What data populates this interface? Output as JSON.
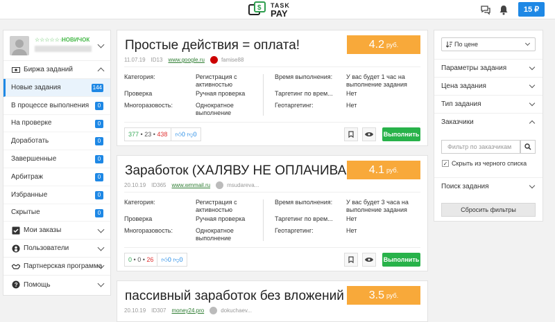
{
  "header": {
    "logo_top": "TASK",
    "logo_bottom": "PAY",
    "balance": "15 ₽",
    "colors": {
      "accent": "#1e88e5",
      "green": "#28b24a",
      "price": "#f8a93a"
    }
  },
  "sidebar": {
    "user": {
      "stars": "☆☆☆☆☆☆",
      "rank": "НОВИЧОК"
    },
    "section_tasks": "Биржа заданий",
    "items": [
      {
        "label": "Новые задания",
        "count": "144"
      },
      {
        "label": "В процессе выполнения",
        "count": "0"
      },
      {
        "label": "На проверке",
        "count": "0"
      },
      {
        "label": "Доработать",
        "count": "0"
      },
      {
        "label": "Завершенные",
        "count": "0"
      },
      {
        "label": "Арбитраж",
        "count": "0"
      },
      {
        "label": "Избранные",
        "count": "0"
      },
      {
        "label": "Скрытые",
        "count": "0"
      }
    ],
    "my_orders": "Мои заказы",
    "users": "Пользователи",
    "partner": "Партнерская программа",
    "help": "Помощь"
  },
  "tasks": [
    {
      "title": "Простые действия = оплата!",
      "price": "4.2",
      "currency": "руб.",
      "date": "11.07.19",
      "id": "ID13",
      "site": "www.google.ru",
      "author": "famise88",
      "category": "Регистрация с активностью",
      "check": "Ручная проверка",
      "repeat": "Однократное выполнение",
      "time": "У вас будет 1 час на выполнение задания",
      "targeting": "Нет",
      "geo": "Нет",
      "stat_green": "377",
      "stat_dark": "23",
      "stat_red": "438",
      "likes": "0",
      "dislikes": "0"
    },
    {
      "title": "Заработок (ХАЛЯВУ НЕ ОПЛАЧИВАЮ !!!...",
      "price": "4.1",
      "currency": "руб.",
      "date": "20.10.19",
      "id": "ID365",
      "site": "www.wmmail.ru",
      "author": "msudareva...",
      "category": "Регистрация с активностью",
      "check": "Ручная проверка",
      "repeat": "Однократное выполнение",
      "time": "У вас будет 3 часа на выполнение задания",
      "targeting": "Нет",
      "geo": "Нет",
      "stat_green": "0",
      "stat_dark": "0",
      "stat_red": "26",
      "likes": "0",
      "dislikes": "0"
    },
    {
      "title": "пассивный заработок без вложений",
      "price": "3.5",
      "currency": "руб.",
      "date": "20.10.19",
      "id": "ID307",
      "site": "money24.pro",
      "author": "dokuchaev..."
    }
  ],
  "labels": {
    "category": "Категория:",
    "check": "Проверка",
    "repeat": "Многоразовость:",
    "time": "Время выполнения:",
    "targeting": "Таргетинг по врем...",
    "geo": "Геотаргетинг:",
    "do": "Выполнить",
    "sep": "•"
  },
  "filters": {
    "sort": "По цене",
    "params": "Параметры задания",
    "price": "Цена задания",
    "type": "Тип задания",
    "customers": "Заказчики",
    "filter_placeholder": "Фильтр по заказчикам",
    "hide_black": "Скрыть из черного списка",
    "search": "Поиск задания",
    "reset": "Сбросить фильтры"
  }
}
